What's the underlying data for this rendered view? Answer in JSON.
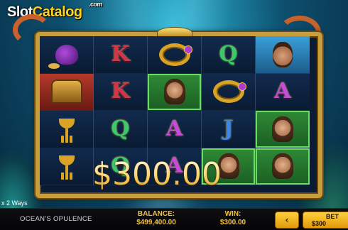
{
  "logo": {
    "prefix": "Slot",
    "accent": "Catalog",
    "suffix": ".com"
  },
  "reels": [
    [
      {
        "symbol": "pouch-icon",
        "win": false
      },
      {
        "symbol": "K",
        "win": false
      },
      {
        "symbol": "ring-icon",
        "win": false
      },
      {
        "symbol": "Q",
        "win": false
      },
      {
        "symbol": "face-icon",
        "win": false
      }
    ],
    [
      {
        "symbol": "chest-icon",
        "win": false
      },
      {
        "symbol": "K",
        "win": false
      },
      {
        "symbol": "mermaid-icon",
        "win": true
      },
      {
        "symbol": "ring-icon",
        "win": false
      },
      {
        "symbol": "A",
        "win": false
      }
    ],
    [
      {
        "symbol": "chalice-icon",
        "win": false
      },
      {
        "symbol": "Q",
        "win": false
      },
      {
        "symbol": "A",
        "win": false
      },
      {
        "symbol": "J",
        "win": false
      },
      {
        "symbol": "mermaid-icon",
        "win": true
      }
    ],
    [
      {
        "symbol": "chalice-icon",
        "win": false
      },
      {
        "symbol": "Q",
        "win": false
      },
      {
        "symbol": "A",
        "win": false
      },
      {
        "symbol": "mermaid-icon",
        "win": true
      },
      {
        "symbol": "mermaid-icon",
        "win": true
      }
    ]
  ],
  "win_amount": "$300.00",
  "ways": "x 2 Ways",
  "bottom_bar": {
    "game_title": "OCEAN'S OPULENCE",
    "balance_label": "BALANCE:",
    "balance_value": "$499,400.00",
    "win_label": "WIN:",
    "win_value": "$300.00",
    "prev_button": "‹",
    "bet_label": "BET",
    "bet_value": "$300"
  }
}
